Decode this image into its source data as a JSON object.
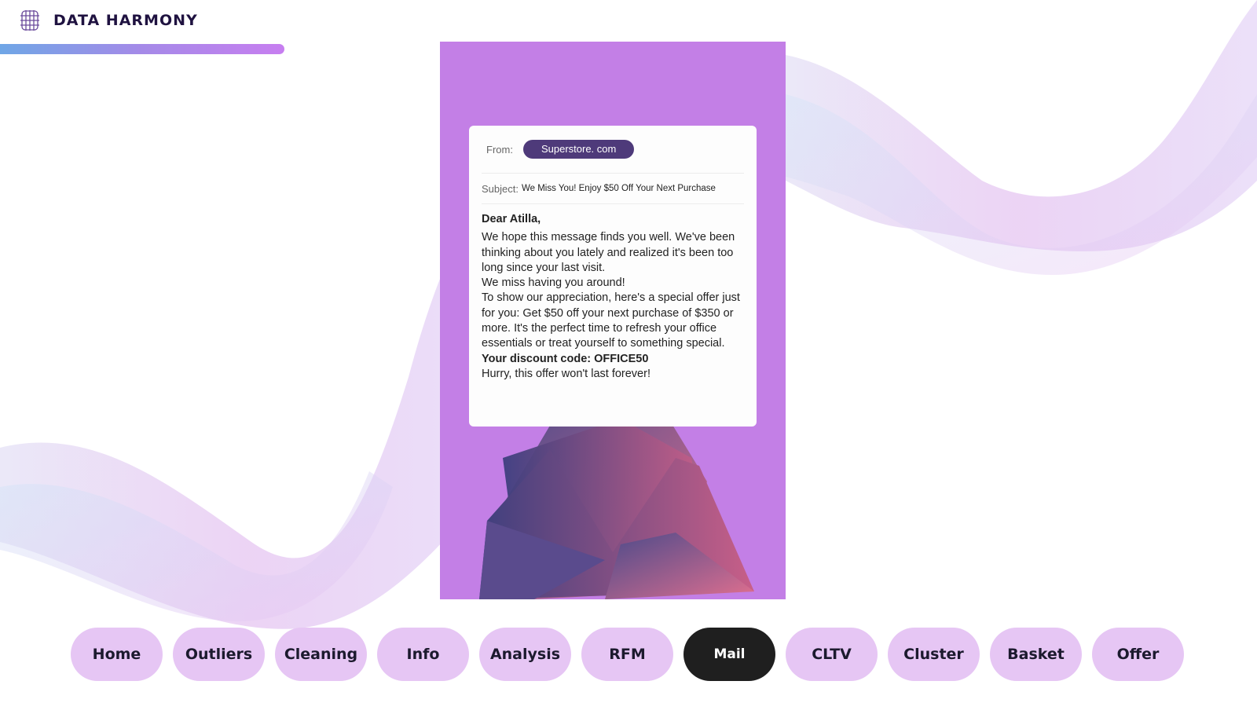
{
  "brand": {
    "title": "DATA HARMONY",
    "logo_icon": "grid-cube-icon"
  },
  "colors": {
    "accent_purple": "#c37fe6",
    "pill_dark": "#4e3a7a",
    "nav_inactive": "#e6c6f4",
    "nav_active": "#1f1f1f"
  },
  "email": {
    "from_label": "From:",
    "from_value": "Superstore. com",
    "subject_label": "Subject:",
    "subject_value": "We Miss You! Enjoy $50 Off Your Next Purchase",
    "greeting": "Dear Atilla,",
    "body_lines": [
      "We hope this message finds you well. We've been thinking about you lately and realized it's been too long since your last visit.",
      "We miss having you around!",
      "To show our appreciation, here's a special offer just for you: Get $50 off your next purchase of $350 or more. It's the perfect time to refresh your office essentials or treat yourself to something special."
    ],
    "discount_line": "Your discount code: OFFICE50",
    "closing": "Hurry, this offer won't last forever!"
  },
  "nav": {
    "items": [
      "Home",
      "Outliers",
      "Cleaning",
      "Info",
      "Analysis",
      "RFM",
      "Mail",
      "CLTV",
      "Cluster",
      "Basket",
      "Offer"
    ],
    "active": "Mail"
  }
}
